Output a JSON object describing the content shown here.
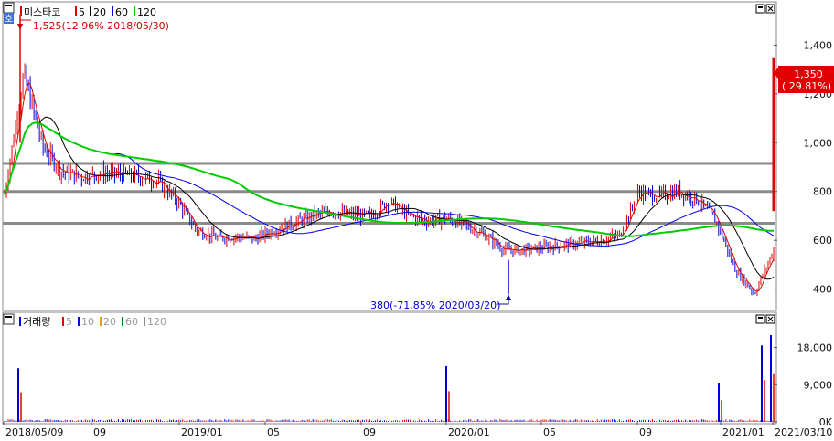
{
  "legend_price": {
    "badge": "호",
    "name": "미스타코",
    "ma": [
      {
        "label": "5",
        "color": "#e00000"
      },
      {
        "label": "20",
        "color": "#000000"
      },
      {
        "label": "60",
        "color": "#0000ee"
      },
      {
        "label": "120",
        "color": "#00cc00"
      }
    ]
  },
  "legend_volume": {
    "name": "거래량",
    "ma": [
      {
        "label": "5",
        "color": "#e00000"
      },
      {
        "label": "10",
        "color": "#0000ee"
      },
      {
        "label": "20",
        "color": "#e0a000"
      },
      {
        "label": "60",
        "color": "#008800"
      },
      {
        "label": "120",
        "color": "#888888"
      }
    ]
  },
  "annotations": {
    "high": "1,525(12.96% 2018/05/30)",
    "low": "380(-71.85% 2020/03/20)"
  },
  "last_price_box": {
    "price": "1,350",
    "change": "( 29.81%)"
  },
  "chart_data": [
    {
      "type": "line",
      "title": "미스타코",
      "ylim": [
        320,
        1570
      ],
      "y_ticks": [
        400,
        600,
        800,
        1000,
        1200,
        1400
      ],
      "y_tick_labels": [
        "400",
        "600",
        "800",
        "1,000",
        "1,200",
        "1,400"
      ],
      "x_ticks": [
        "2018/05/09",
        "09",
        "2019/01",
        "05",
        "09",
        "2020/01",
        "05",
        "09",
        "2021/01",
        "2021/03/10"
      ],
      "horizontal_lines": [
        915,
        800,
        670
      ],
      "series": [
        {
          "name": "5",
          "color": "#e00000"
        },
        {
          "name": "20",
          "color": "#000000"
        },
        {
          "name": "60",
          "color": "#0000ee"
        },
        {
          "name": "120",
          "color": "#00cc00"
        }
      ],
      "x": [
        0,
        1,
        2,
        3,
        4,
        5,
        6,
        7,
        8,
        9,
        10,
        11,
        12,
        13,
        14,
        15,
        16,
        17,
        18,
        19,
        20,
        21,
        22,
        23,
        24,
        25,
        26,
        27,
        28,
        29,
        30,
        31,
        32,
        33,
        34,
        35,
        36,
        37,
        38,
        39,
        40
      ],
      "close": [
        790,
        1280,
        980,
        880,
        860,
        875,
        870,
        860,
        840,
        760,
        640,
        610,
        615,
        605,
        640,
        670,
        700,
        720,
        705,
        700,
        760,
        700,
        680,
        690,
        660,
        620,
        560,
        560,
        570,
        580,
        590,
        600,
        620,
        800,
        780,
        800,
        770,
        680,
        480,
        380,
        560
      ]
    },
    {
      "type": "bar",
      "title": "거래량",
      "ylim": [
        0,
        23000
      ],
      "y_ticks": [
        0,
        9000,
        18000
      ],
      "y_tick_labels": [
        "0K",
        "9,000",
        "18,000"
      ],
      "spikes": [
        {
          "x": 12,
          "value": 13000
        },
        {
          "x": 480,
          "value": 13500
        },
        {
          "x": 778,
          "value": 9500
        },
        {
          "x": 825,
          "value": 18500
        },
        {
          "x": 835,
          "value": 21000
        }
      ]
    }
  ]
}
